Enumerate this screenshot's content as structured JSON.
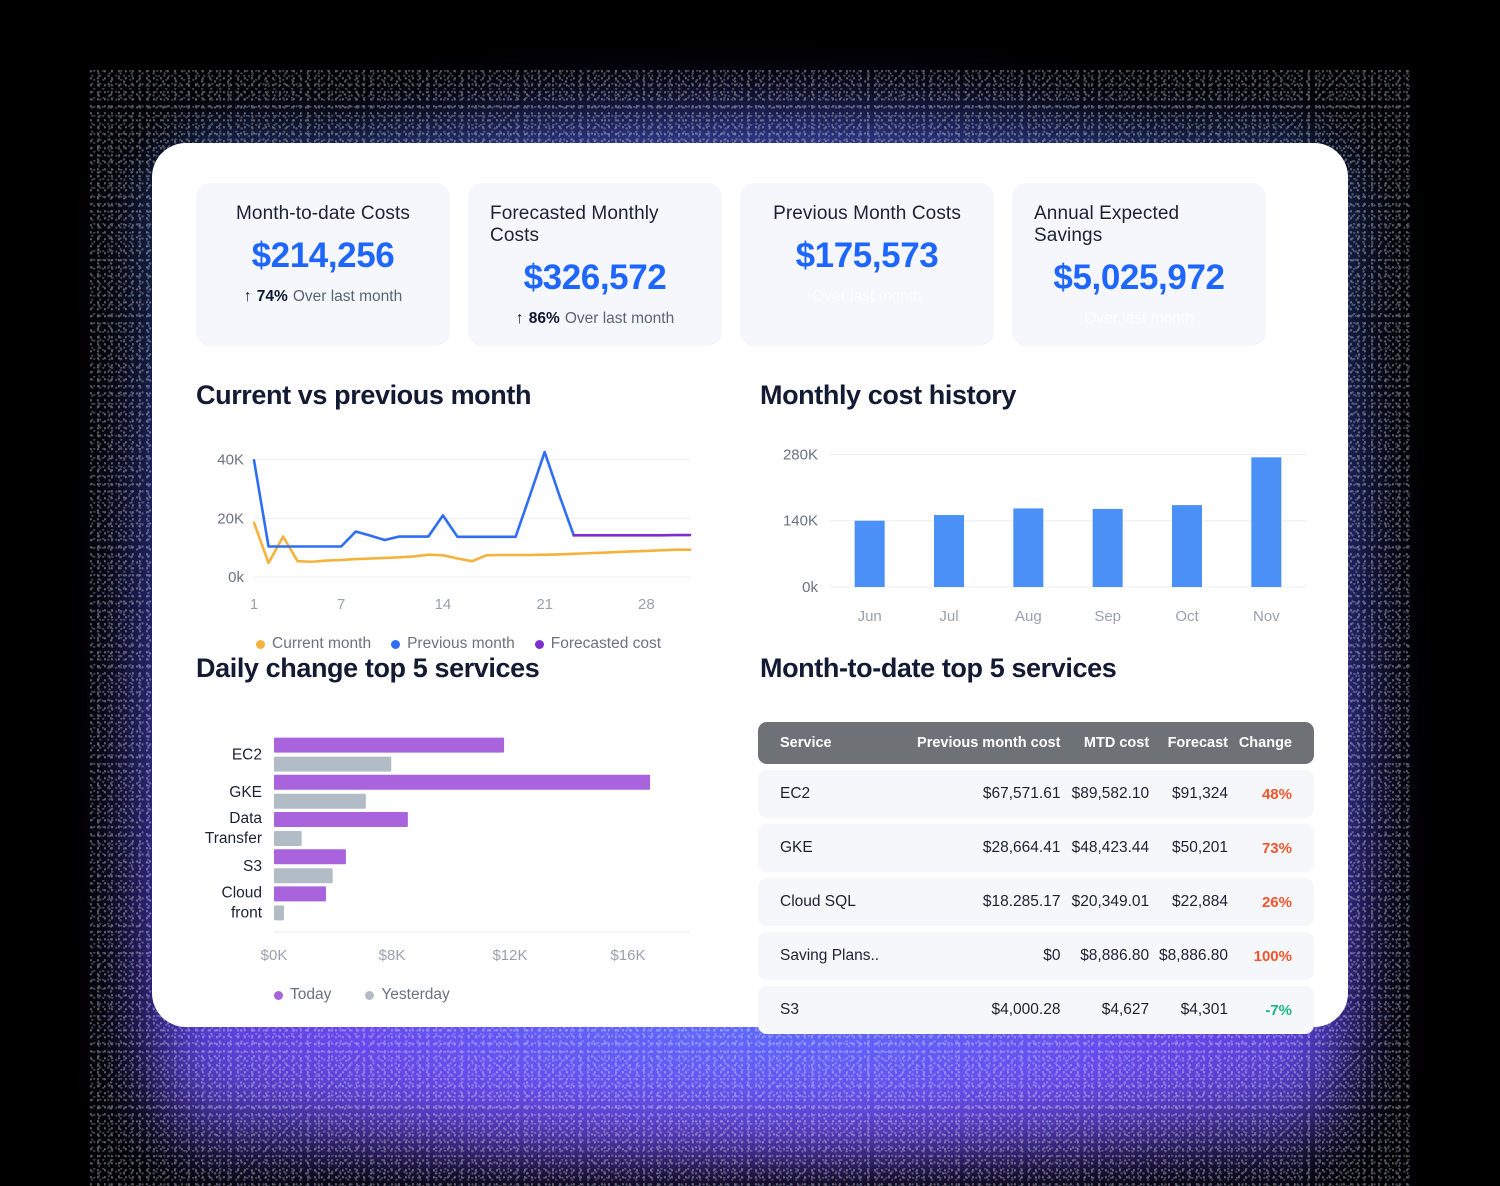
{
  "kpis": [
    {
      "title": "Month-to-date Costs",
      "value": "$214,256",
      "arrow": "↑",
      "pct": "74%",
      "note": "Over last month",
      "faded": false
    },
    {
      "title": "Forecasted Monthly Costs",
      "value": "$326,572",
      "arrow": "↑",
      "pct": "86%",
      "note": "Over last month",
      "faded": false
    },
    {
      "title": "Previous Month Costs",
      "value": "$175,573",
      "arrow": "",
      "pct": "",
      "note": "Over last month",
      "faded": true
    },
    {
      "title": "Annual Expected Savings",
      "value": "$5,025,972",
      "arrow": "",
      "pct": "",
      "note": "Over last month",
      "faded": true
    }
  ],
  "panels": {
    "line_title": "Current vs previous month",
    "bar_title": "Monthly cost history",
    "hbar_title": "Daily change top 5 services",
    "table_title": "Month-to-date top 5 services"
  },
  "colors": {
    "accent_blue": "#1f66ff",
    "series_current": "#f5b33c",
    "series_previous": "#2f6df6",
    "series_forecast": "#7b2fd1",
    "bar_blue": "#4a90f7",
    "today_purple": "#a963dd",
    "yesterday_gray": "#b2bcc6",
    "up": "#f2552c",
    "down": "#16b97f",
    "table_header": "#6e7276"
  },
  "chart_data": [
    {
      "type": "line",
      "title": "Current vs previous month",
      "xlabel": "",
      "ylabel": "",
      "x": [
        1,
        2,
        3,
        4,
        5,
        6,
        7,
        8,
        9,
        10,
        11,
        12,
        13,
        14,
        15,
        16,
        17,
        18,
        19,
        20,
        21,
        22,
        23,
        24,
        25,
        26,
        27,
        28,
        29,
        30,
        31
      ],
      "xticks": [
        1,
        7,
        14,
        21,
        28
      ],
      "yticks": [
        "0k",
        "20K",
        "40K"
      ],
      "ylim": [
        0,
        45000
      ],
      "grid": true,
      "legend_position": "bottom",
      "series": [
        {
          "name": "Current month",
          "color": "#f5b33c",
          "values": [
            18500,
            4800,
            13800,
            5400,
            5200,
            5600,
            5800,
            6100,
            6300,
            6500,
            6700,
            7000,
            7600,
            7400,
            6300,
            5400,
            7400,
            7500,
            7500,
            7500,
            7600,
            7700,
            7900,
            8100,
            8300,
            8500,
            8700,
            8900,
            9100,
            9300,
            9300
          ]
        },
        {
          "name": "Previous month",
          "color": "#2f6df6",
          "values": [
            39800,
            10400,
            10400,
            10400,
            10400,
            10400,
            10400,
            15500,
            14100,
            12600,
            13800,
            13800,
            13800,
            21000,
            13700,
            13700,
            13700,
            13700,
            13700,
            28000,
            42600,
            28000,
            14200,
            null,
            null,
            null,
            null,
            null,
            null,
            null,
            null
          ]
        },
        {
          "name": "Forecasted cost",
          "color": "#7b2fd1",
          "values": [
            null,
            null,
            null,
            null,
            null,
            null,
            null,
            null,
            null,
            null,
            null,
            null,
            null,
            null,
            null,
            null,
            null,
            null,
            null,
            null,
            null,
            null,
            14200,
            14200,
            14200,
            14200,
            14200,
            14200,
            14200,
            14300,
            14300
          ]
        }
      ]
    },
    {
      "type": "bar",
      "title": "Monthly cost history",
      "categories": [
        "Jun",
        "Jul",
        "Aug",
        "Sep",
        "Oct",
        "Nov"
      ],
      "values": [
        140000,
        152000,
        166000,
        165000,
        173000,
        274000
      ],
      "yticks": [
        "0k",
        "140K",
        "280K"
      ],
      "ylim": [
        0,
        300000
      ],
      "xlabel": "",
      "ylabel": "",
      "grid": true,
      "color": "#4a90f7"
    },
    {
      "type": "bar",
      "orientation": "horizontal",
      "title": "Daily change top 5 services",
      "categories": [
        "EC2",
        "GKE",
        "Data Transfer",
        "S3",
        "Cloud front"
      ],
      "xticks": [
        "$0K",
        "$8K",
        "$12K",
        "$16K"
      ],
      "xlim": [
        0,
        16000
      ],
      "grid": false,
      "legend_position": "bottom",
      "series": [
        {
          "name": "Today",
          "color": "#a963dd",
          "values": [
            10400,
            17000,
            6050,
            3250,
            2350
          ]
        },
        {
          "name": "Yesterday",
          "color": "#b2bcc6",
          "values": [
            5300,
            4150,
            1250,
            2650,
            450
          ]
        }
      ]
    },
    {
      "type": "table",
      "title": "Month-to-date top 5 services",
      "columns": [
        "Service",
        "Previous month cost",
        "MTD cost",
        "Forecast",
        "Change"
      ],
      "rows": [
        [
          "EC2",
          "$67,571.61",
          "$89,582.10",
          "$91,324",
          "48%"
        ],
        [
          "GKE",
          "$28,664.41",
          "$48,423.44",
          "$50,201",
          "73%"
        ],
        [
          "Cloud SQL",
          "$18.285.17",
          "$20,349.01",
          "$22,884",
          "26%"
        ],
        [
          "Saving Plans..",
          "$0",
          "$8,886.80",
          "$8,886.80",
          "100%"
        ],
        [
          "S3",
          "$4,000.28",
          "$4,627",
          "$4,301",
          "-7%"
        ]
      ],
      "change_direction": [
        "up",
        "up",
        "up",
        "up",
        "down"
      ]
    }
  ]
}
